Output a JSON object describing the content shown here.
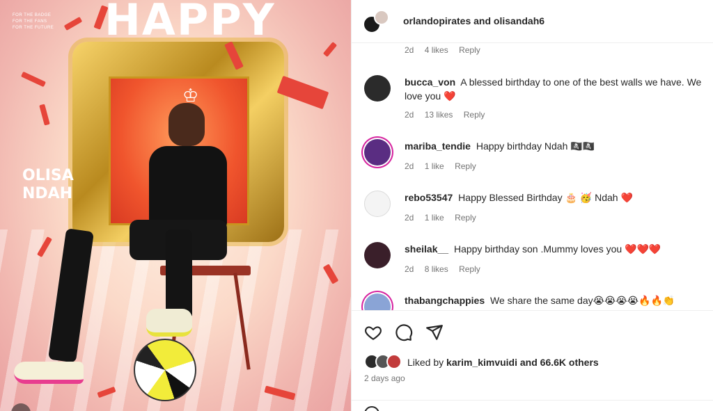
{
  "post_image": {
    "tagline_lines": [
      "FOR THE BADGE",
      "FOR THE FANS",
      "FOR THE FUTURE"
    ],
    "headline": "HAPPY",
    "player_name_lines": [
      "OLISA",
      "NDAH"
    ]
  },
  "post_header": {
    "account": "orlandopirates",
    "conjunction": "and",
    "collaborator": "olisandah6"
  },
  "top_comment_meta": {
    "time": "2d",
    "likes": "4 likes",
    "reply": "Reply"
  },
  "comments": [
    {
      "user": "bucca_von",
      "text": "A blessed birthday to one of the best walls we have. We love you",
      "emoji": "❤️",
      "time": "2d",
      "likes": "13 likes",
      "reply": "Reply",
      "avatar_color": "#2b2b2b"
    },
    {
      "user": "mariba_tendie",
      "text": "Happy birthday Ndah",
      "emoji": "🏴‍☠️🏴‍☠️",
      "time": "2d",
      "likes": "1 like",
      "reply": "Reply",
      "avatar_color": "#5a2d82"
    },
    {
      "user": "rebo53547",
      "text": "Happy Blessed Birthday 🎂 🥳 Ndah",
      "emoji": "❤️",
      "time": "2d",
      "likes": "1 like",
      "reply": "Reply",
      "avatar_color": "#f4f4f4"
    },
    {
      "user": "sheilak__",
      "text": "Happy birthday son .Mummy loves you",
      "emoji": "❤️❤️❤️",
      "time": "2d",
      "likes": "8 likes",
      "reply": "Reply",
      "avatar_color": "#3a1f2a"
    },
    {
      "user": "thabangchappies",
      "text": "We share the same day😭😭😭😭🔥🔥👏",
      "emoji": "",
      "time": "",
      "likes": "",
      "reply": "",
      "avatar_color": "#8aa4d6"
    }
  ],
  "actions": {
    "icons": [
      "heart-icon",
      "comment-icon",
      "share-icon"
    ]
  },
  "likes": {
    "prefix": "Liked by",
    "user": "karim_kimvuidi",
    "suffix": "and 66.6K others"
  },
  "post_time": "2 days ago",
  "colors": {
    "heart": "#e0243a",
    "muted_text": "#737373",
    "primary_text": "#262626"
  }
}
